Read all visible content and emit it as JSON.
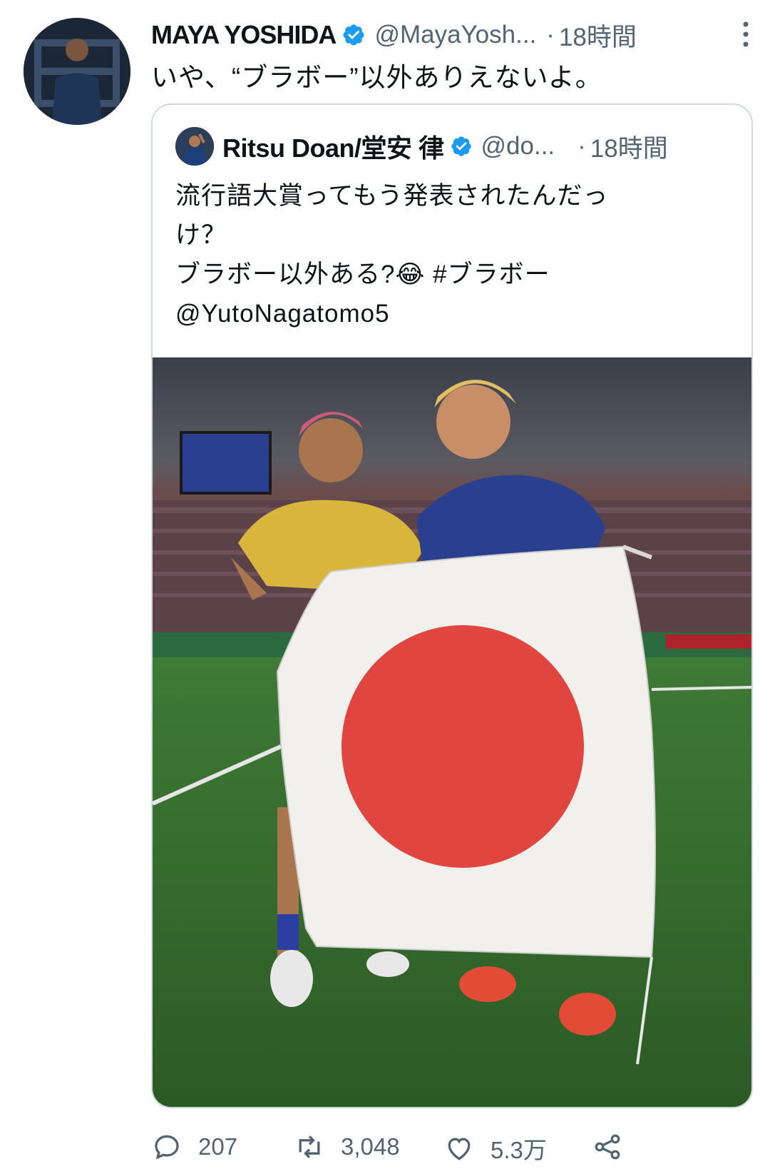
{
  "tweet": {
    "author_name": "MAYA YOSHIDA",
    "author_handle": "@MayaYosh...",
    "separator": "·",
    "time": "18時間",
    "more_icon": "more-vertical-icon",
    "text": "いや、“ブラボー”以外ありえないよ。"
  },
  "quote": {
    "author_name": "Ritsu Doan/堂安 律",
    "author_handle": "@do...",
    "separator": "·",
    "time": "18時間",
    "text_lines": [
      "流行語大賞ってもう発表されたんだっ",
      "け？"
    ],
    "line3_prefix": "ブラボー以外ある?",
    "emoji": "😂",
    "hashtag": "#ブラボー",
    "mention": "@YutoNagatomo5"
  },
  "actions": {
    "reply_count": "207",
    "retweet_count": "3,048",
    "like_count": "5.3万"
  },
  "colors": {
    "verified": "#1d9bf0",
    "secondary_text": "#536471",
    "border": "#cfd9de"
  }
}
